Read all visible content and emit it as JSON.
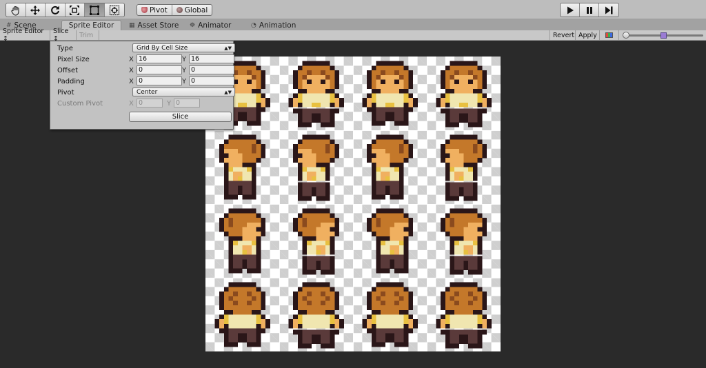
{
  "toolbar": {
    "tools": [
      {
        "name": "hand-tool-icon"
      },
      {
        "name": "move-tool-icon"
      },
      {
        "name": "rotate-tool-icon"
      },
      {
        "name": "scale-tool-icon"
      },
      {
        "name": "rect-tool-icon"
      },
      {
        "name": "transform-tool-icon"
      }
    ],
    "pivot_label": "Pivot",
    "global_label": "Global",
    "play_icons": [
      "play-icon",
      "pause-icon",
      "step-icon"
    ]
  },
  "tabs": [
    {
      "label": "Scene",
      "icon": "#",
      "active": false
    },
    {
      "label": "Sprite Editor",
      "icon": "",
      "active": true
    },
    {
      "label": "Asset Store",
      "icon": "▦",
      "active": false
    },
    {
      "label": "Animator",
      "icon": "☸",
      "active": false
    },
    {
      "label": "Animation",
      "icon": "◔",
      "active": false
    }
  ],
  "sprite_toolbar": {
    "mode_label": "Sprite Editor ↕",
    "slice_label": "Slice ↕",
    "trim_label": "Trim",
    "revert_label": "Revert",
    "apply_label": "Apply",
    "zoom_level": 0.48
  },
  "slice_popup": {
    "type_label": "Type",
    "type_value": "Grid By Cell Size",
    "pixel_size_label": "Pixel Size",
    "pixel_size_x": "16",
    "pixel_size_y": "16",
    "offset_label": "Offset",
    "offset_x": "0",
    "offset_y": "0",
    "padding_label": "Padding",
    "padding_x": "0",
    "padding_y": "0",
    "pivot_label": "Pivot",
    "pivot_value": "Center",
    "custom_pivot_label": "Custom Pivot",
    "custom_pivot_x": "0",
    "custom_pivot_y": "0",
    "x_axis": "X",
    "y_axis": "Y",
    "slice_button": "Slice"
  },
  "sprite_sheet": {
    "rows": 4,
    "cols": 4,
    "rows_direction": [
      "down",
      "left",
      "right",
      "up"
    ]
  },
  "colors": {
    "hair": "#c4782a",
    "hair_dark": "#8a4a1e",
    "skin": "#f0b060",
    "outline": "#2a1618",
    "shirt": "#f0e6b0",
    "pants": "#5a3a3a",
    "accent": "#e8c040"
  }
}
